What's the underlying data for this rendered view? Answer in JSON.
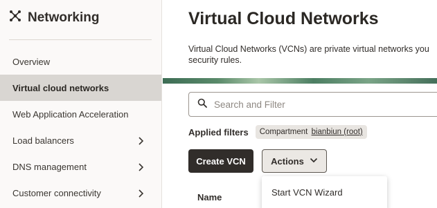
{
  "sidebar": {
    "title": "Networking",
    "icon": "network-icon",
    "items": [
      {
        "label": "Overview",
        "has_submenu": false,
        "active": false
      },
      {
        "label": "Virtual cloud networks",
        "has_submenu": false,
        "active": true
      },
      {
        "label": "Web Application Acceleration",
        "has_submenu": false,
        "active": false
      },
      {
        "label": "Load balancers",
        "has_submenu": true,
        "active": false
      },
      {
        "label": "DNS management",
        "has_submenu": true,
        "active": false
      },
      {
        "label": "Customer connectivity",
        "has_submenu": true,
        "active": false
      }
    ]
  },
  "main": {
    "title": "Virtual Cloud Networks",
    "description": "Virtual Cloud Networks (VCNs) are private virtual networks you security rules.",
    "search": {
      "placeholder": "Search and Filter",
      "value": "",
      "icon": "search-icon"
    },
    "applied_filters": {
      "label": "Applied filters",
      "chip_key": "Compartment",
      "chip_value": "bianbiun (root)"
    },
    "create_button_label": "Create VCN",
    "actions_button_label": "Actions",
    "actions_menu": {
      "items": [
        "Start VCN Wizard"
      ]
    },
    "table": {
      "columns": [
        "Name"
      ]
    }
  },
  "colors": {
    "sidebar_bg": "#fbf9f8",
    "active_item_bg": "#d9d6d2",
    "primary_button": "#312d2a",
    "banner_green": "#4c7e62"
  }
}
